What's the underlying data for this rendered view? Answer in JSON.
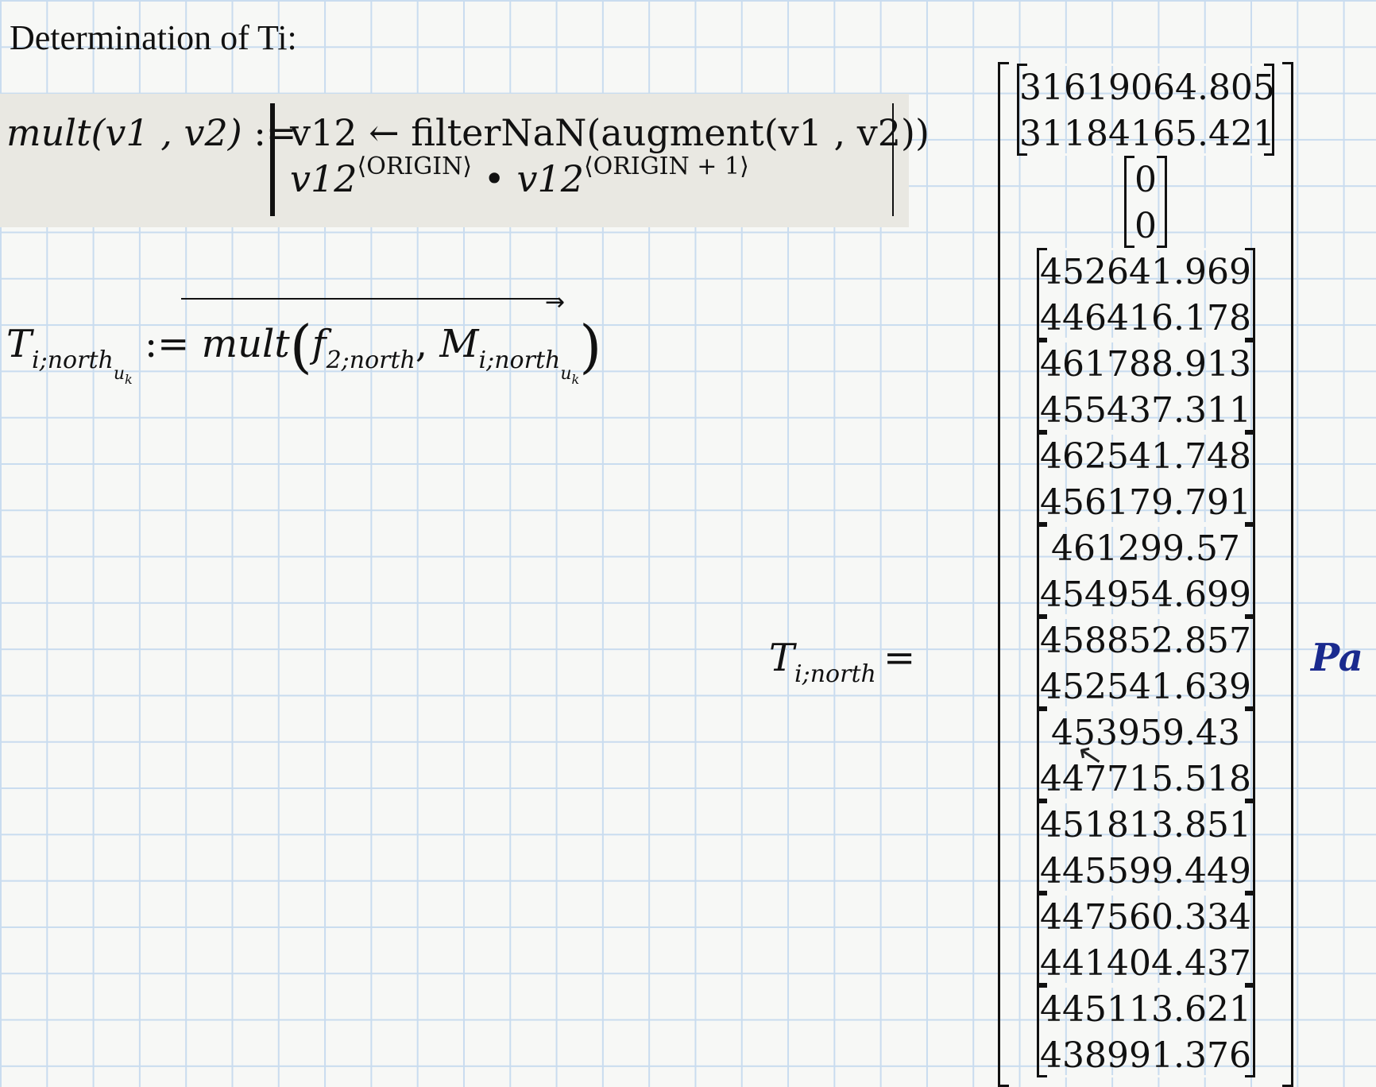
{
  "heading": "Determination of  Ti:",
  "program": {
    "lhs": "mult(v1 , v2)",
    "assign": ":=",
    "line1": "v12 ← filterNaN(augment(v1 , v2))",
    "line2_base1": "v12",
    "line2_sup1": "⟨ORIGIN⟩",
    "line2_dot": "•",
    "line2_base2": "v12",
    "line2_sup2": "⟨ORIGIN + 1⟩"
  },
  "definition": {
    "lhs_var": "T",
    "lhs_sub": "i;north",
    "lhs_subsub": "u",
    "lhs_subsubsub": "k",
    "assign": ":=",
    "func": "mult",
    "arg1_var": "f",
    "arg1_sub": "2;north",
    "arg2_var": "M",
    "arg2_sub": "i;north",
    "arg2_subsub": "u",
    "arg2_subsubsub": "k"
  },
  "result": {
    "lhs_var": "T",
    "lhs_sub": "i;north",
    "eq": "=",
    "unit": "Pa",
    "blocks": [
      [
        "31619064.805",
        "31184165.421"
      ],
      [
        "0",
        "0"
      ],
      [
        "452641.969",
        "446416.178"
      ],
      [
        "461788.913",
        "455437.311"
      ],
      [
        "462541.748",
        "456179.791"
      ],
      [
        "461299.57",
        "454954.699"
      ],
      [
        "458852.857",
        "452541.639"
      ],
      [
        "453959.43",
        "447715.518"
      ],
      [
        "451813.851",
        "445599.449"
      ],
      [
        "447560.334",
        "441404.437"
      ],
      [
        "445113.621",
        "438991.376"
      ]
    ]
  }
}
